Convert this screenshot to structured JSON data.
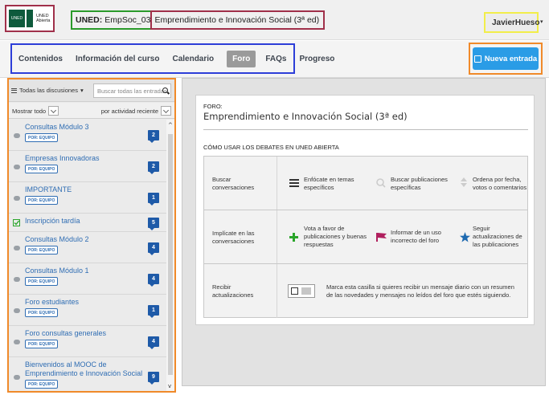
{
  "header": {
    "logo_mark": "UNED",
    "logo_text_line1": "UNED",
    "logo_text_line2": "Abierta",
    "course_prefix": "UNED:",
    "course_code": "EmpSoc_03",
    "course_name": "Emprendimiento e Innovación Social (3ª ed)",
    "user_name": "JavierHueso",
    "user_caret": "▾"
  },
  "nav": {
    "items": [
      {
        "label": "Contenidos",
        "active": false
      },
      {
        "label": "Información del curso",
        "active": false
      },
      {
        "label": "Calendario",
        "active": false
      },
      {
        "label": "Foro",
        "active": true
      },
      {
        "label": "FAQs",
        "active": false
      },
      {
        "label": "Progreso",
        "active": false
      }
    ],
    "new_entry_label": "Nueva entrada"
  },
  "sidebar": {
    "filter_label": "Todas las discusiones",
    "filter_caret": "▾",
    "search_placeholder": "Buscar todas las entradas",
    "show_label": "Mostrar todo",
    "sort_label": "por actividad reciente",
    "tag_label": "POR: EQUIPO",
    "threads": [
      {
        "title": "Consultas Módulo 3",
        "count": "2",
        "tag": true,
        "icon": "comment-icon"
      },
      {
        "title": "Empresas Innovadoras",
        "count": "2",
        "tag": true,
        "icon": "comment-icon"
      },
      {
        "title": "IMPORTANTE",
        "count": "1",
        "tag": true,
        "icon": "comment-icon"
      },
      {
        "title": "Inscripción tardía",
        "count": "5",
        "tag": false,
        "icon": "check-icon"
      },
      {
        "title": "Consultas Módulo 2",
        "count": "4",
        "tag": true,
        "icon": "comment-icon"
      },
      {
        "title": "Consultas Módulo 1",
        "count": "4",
        "tag": true,
        "icon": "comment-icon"
      },
      {
        "title": "Foro estudiantes",
        "count": "1",
        "tag": true,
        "icon": "comment-icon"
      },
      {
        "title": "Foro consultas generales",
        "count": "4",
        "tag": true,
        "icon": "comment-icon"
      },
      {
        "title": "Bienvenidos al MOOC de Emprendimiento e Innovación Social",
        "count": "9",
        "tag": true,
        "icon": "comment-icon"
      }
    ]
  },
  "main": {
    "foro_label": "FORO:",
    "foro_title": "Emprendimiento e Innovación Social (3ª ed)",
    "howto_title": "CÓMO USAR LOS DEBATES EN UNED ABIERTA",
    "rows": [
      {
        "label": "Buscar conversaciones",
        "cells": [
          {
            "icon": "list-icon",
            "text": "Enfócate en temas específicos"
          },
          {
            "icon": "search-icon",
            "text": "Buscar publicaciones específicas"
          },
          {
            "icon": "sort-icon",
            "text": "Ordena por fecha, votos o comentarios"
          }
        ]
      },
      {
        "label": "Implícate en las conversaciones",
        "cells": [
          {
            "icon": "plus-icon",
            "text": "Vota a favor de publicaciones y buenas respuestas"
          },
          {
            "icon": "flag-icon",
            "text": "Informar de un uso incorrecto del foro"
          },
          {
            "icon": "star-icon",
            "text": "Seguir actualizaciones de las publicaciones"
          }
        ]
      },
      {
        "label": "Recibir actualizaciones",
        "text": "Marca esta casilla si quieres recibir un mensaje diario con un resumen de las novedades y mensajes no leídos del foro que estés siguiendo."
      }
    ]
  },
  "colors": {
    "accent_blue": "#2a9ce6",
    "badge_blue": "#1e5aa8",
    "link_blue": "#2f6db3",
    "brand_green": "#0e5a3c",
    "plus_green": "#2aa52a",
    "flag_magenta": "#b0205e",
    "star_blue": "#1e6ab0"
  }
}
